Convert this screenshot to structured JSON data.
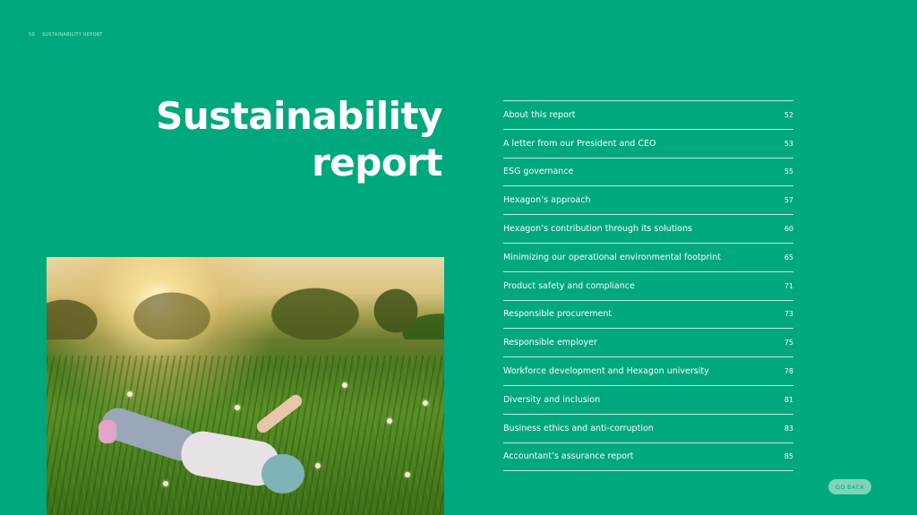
{
  "header": {
    "page_number": "50",
    "section": "SUSTAINABILITY REPORT"
  },
  "title": {
    "line1": "Sustainability",
    "line2": "report"
  },
  "toc": [
    {
      "label": "About this report",
      "page": "52"
    },
    {
      "label": "A letter from our President and CEO",
      "page": "53"
    },
    {
      "label": "ESG governance",
      "page": "55"
    },
    {
      "label": "Hexagon’s approach",
      "page": "57"
    },
    {
      "label": "Hexagon’s contribution through its solutions",
      "page": "60"
    },
    {
      "label": "Minimizing our operational environmental footprint",
      "page": "65"
    },
    {
      "label": "Product safety and compliance",
      "page": "71"
    },
    {
      "label": "Responsible procurement",
      "page": "73"
    },
    {
      "label": "Responsible employer",
      "page": "75"
    },
    {
      "label": "Workforce development and Hexagon university",
      "page": "78"
    },
    {
      "label": "Diversity and inclusion",
      "page": "81"
    },
    {
      "label": "Business ethics and anti-corruption",
      "page": "83"
    },
    {
      "label": "Accountant’s assurance report",
      "page": "85"
    }
  ],
  "go_back_label": "GO BACK",
  "colors": {
    "background": "#00a87e",
    "text": "#ffffff",
    "button": "#7fd3b9"
  }
}
